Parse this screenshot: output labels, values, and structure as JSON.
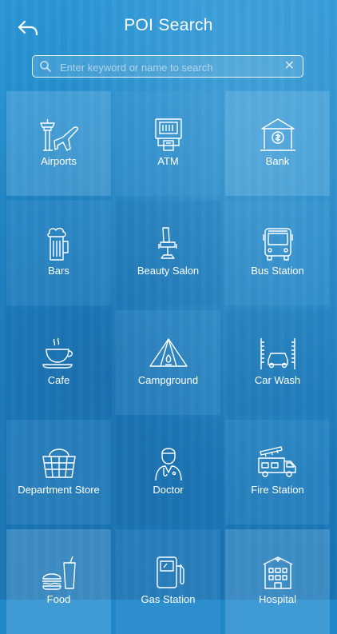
{
  "header": {
    "title": "POI Search",
    "back_icon": "back-arrow-icon"
  },
  "search": {
    "placeholder": "Enter keyword or name to search",
    "value": "",
    "clear_label": "✕",
    "icon": "search-icon"
  },
  "categories": [
    {
      "label": "Airports",
      "icon": "airport-icon"
    },
    {
      "label": "ATM",
      "icon": "atm-icon"
    },
    {
      "label": "Bank",
      "icon": "bank-icon"
    },
    {
      "label": "Bars",
      "icon": "beer-mug-icon"
    },
    {
      "label": "Beauty Salon",
      "icon": "salon-chair-icon"
    },
    {
      "label": "Bus Station",
      "icon": "bus-icon"
    },
    {
      "label": "Cafe",
      "icon": "coffee-cup-icon"
    },
    {
      "label": "Campground",
      "icon": "tent-icon"
    },
    {
      "label": "Car Wash",
      "icon": "car-wash-icon"
    },
    {
      "label": "Department Store",
      "icon": "shopping-basket-icon"
    },
    {
      "label": "Doctor",
      "icon": "doctor-icon"
    },
    {
      "label": "Fire Station",
      "icon": "fire-truck-icon"
    },
    {
      "label": "Food",
      "icon": "burger-drink-icon"
    },
    {
      "label": "Gas Station",
      "icon": "fuel-pump-icon"
    },
    {
      "label": "Hospital",
      "icon": "hospital-building-icon"
    }
  ]
}
